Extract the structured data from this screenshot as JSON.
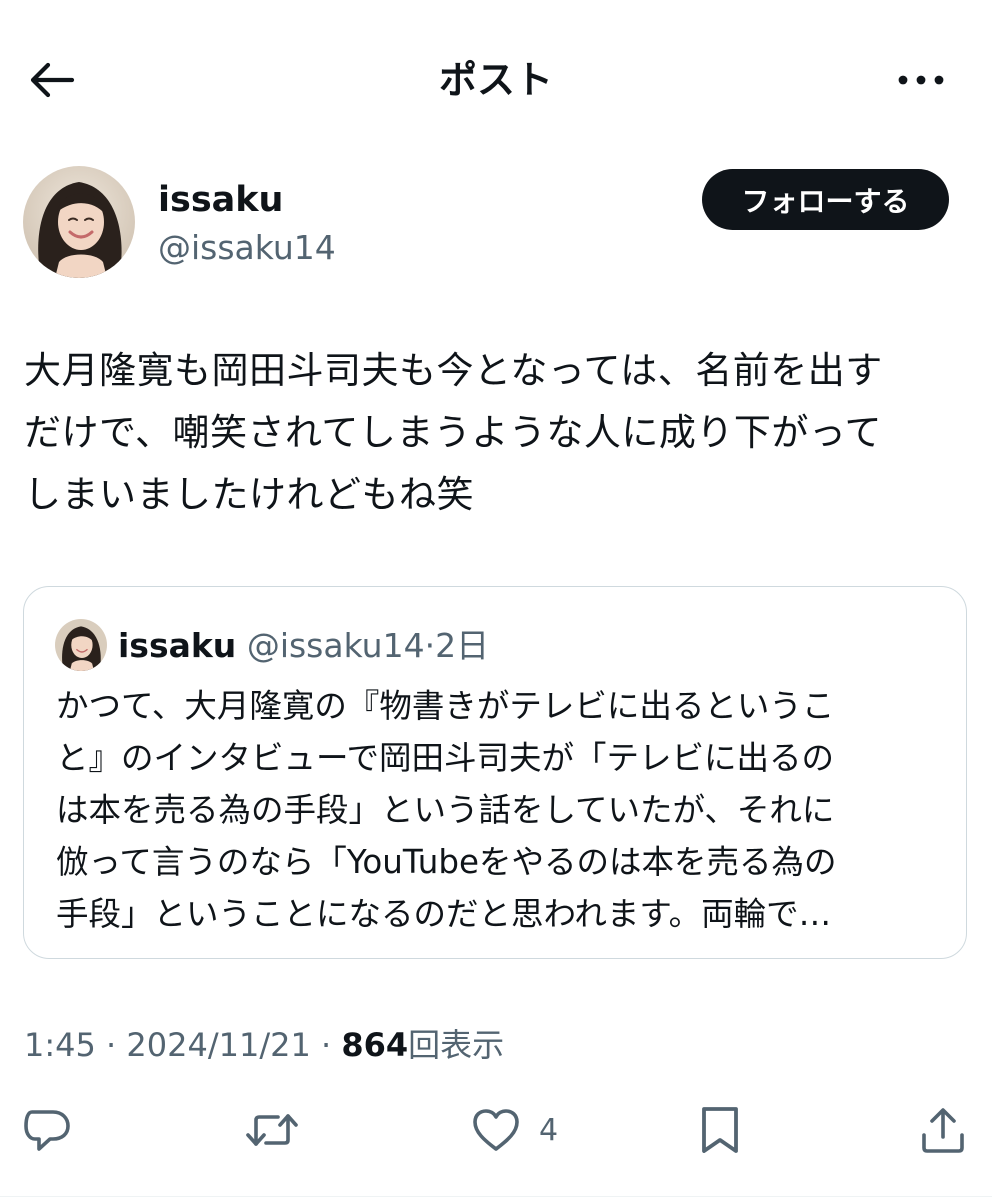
{
  "header": {
    "title": "ポスト",
    "back_icon": "arrow-left-icon",
    "more_icon": "more-horizontal-icon"
  },
  "author": {
    "name": "issaku",
    "handle": "@issaku14",
    "follow_label": "フォローする"
  },
  "post": {
    "lines": [
      "大月隆寛も岡田斗司夫も今となっては、名前を出す",
      "だけで、嘲笑されてしまうような人に成り下がって",
      "しまいましたけれどもね笑"
    ]
  },
  "quote": {
    "name": "issaku",
    "handle": "@issaku14",
    "separator": "·",
    "time": "2日",
    "lines": [
      "かつて、大月隆寛の『物書きがテレビに出るというこ",
      "と』のインタビューで岡田斗司夫が「テレビに出るの",
      "は本を売る為の手段」という話をしていたが、それに",
      "倣って言うのなら「YouTubeをやるのは本を売る為の",
      "手段」ということになるのだと思われます。両輪で…"
    ]
  },
  "meta": {
    "time": "1:45",
    "separator": "·",
    "date": "2024/11/21",
    "views_count": "864",
    "views_label": "回表示"
  },
  "actions": {
    "reply_icon": "reply-icon",
    "repost_icon": "repost-icon",
    "like_icon": "heart-icon",
    "like_count": "4",
    "bookmark_icon": "bookmark-icon",
    "share_icon": "share-icon"
  },
  "colors": {
    "text_primary": "#0f1419",
    "text_secondary": "#536471",
    "border": "#cfd9de",
    "follow_bg": "#0f1419"
  }
}
